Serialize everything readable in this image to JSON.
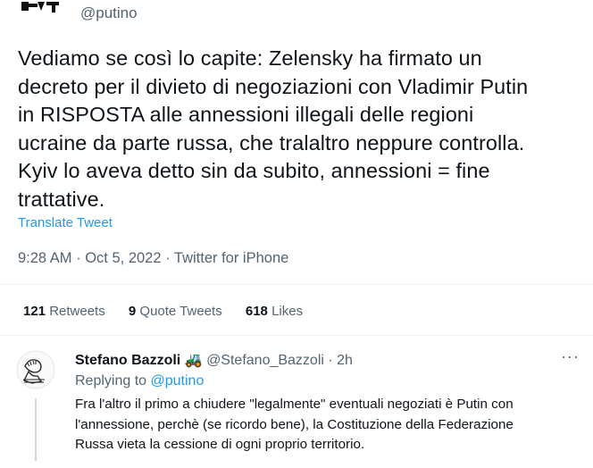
{
  "author": {
    "handle": "@putino",
    "avatar_icon": "profile-logo-icon"
  },
  "tweet": {
    "text": "Vediamo se così lo capite: Zelensky ha firmato un\ndecreto per il divieto di negoziazioni con Vladimir Putin\nin RISPOSTA alle annessioni illegali delle regioni\nucraine da parte russa, che tralaltro neppure controlla.\nKyiv lo aveva detto sin da subito, annessioni = fine\ntrattative.",
    "translate_label": "Translate Tweet",
    "time": "9:28 AM",
    "date": "Oct 5, 2022",
    "source": "Twitter for iPhone",
    "sep": " · "
  },
  "stats": {
    "retweets": {
      "count": "121",
      "label": " Retweets"
    },
    "quotes": {
      "count": "9",
      "label": " Quote Tweets"
    },
    "likes": {
      "count": "618",
      "label": " Likes"
    }
  },
  "reply": {
    "name": "Stefano Bazzoli",
    "emoji": "🚜",
    "handle": "@Stefano_Bazzoli",
    "time": "2h",
    "replying_prefix": "Replying to ",
    "replying_to": "@putino",
    "text": "Fra l'altro il primo a chiudere \"legalmente\" eventuali negoziati è Putin con\nl'annessione, perchè (se ricordo bene), la Costituzione della Federazione\nRussa vieta la cessione di ogni proprio territorio.",
    "more": "···"
  },
  "colors": {
    "link": "#1d9bf0",
    "secondary": "#536471",
    "text": "#0f1419"
  }
}
